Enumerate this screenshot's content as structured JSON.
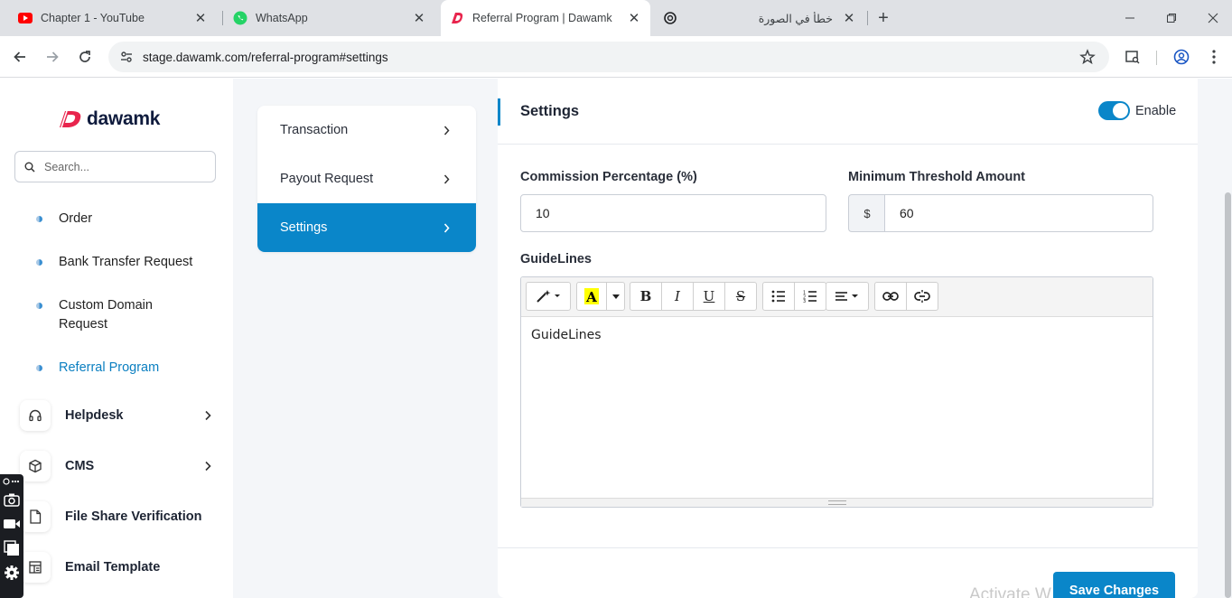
{
  "browser": {
    "tabs": [
      {
        "title": "Chapter 1 - YouTube",
        "favicon": "youtube-icon"
      },
      {
        "title": "WhatsApp",
        "favicon": "whatsapp-icon"
      },
      {
        "title": "Referral Program | Dawamk",
        "favicon": "dawamk-icon",
        "active": true
      },
      {
        "title": "خطأ في الصورة",
        "favicon": "chatgpt-icon"
      }
    ],
    "url": "stage.dawamk.com/referral-program#settings"
  },
  "sidebar": {
    "brand": "dawamk",
    "search_placeholder": "Search...",
    "sub_items": [
      {
        "label": "Order"
      },
      {
        "label": "Bank Transfer Request"
      },
      {
        "label": "Custom Domain Request"
      },
      {
        "label": "Referral Program",
        "active": true
      }
    ],
    "menu_items": [
      {
        "label": "Helpdesk",
        "icon": "headset-icon"
      },
      {
        "label": "CMS",
        "icon": "cube-icon"
      },
      {
        "label": "File Share Verification",
        "icon": "file-icon"
      },
      {
        "label": "Email Template",
        "icon": "template-icon"
      }
    ]
  },
  "subnav": {
    "items": [
      {
        "label": "Transaction"
      },
      {
        "label": "Payout Request"
      },
      {
        "label": "Settings",
        "active": true
      }
    ]
  },
  "settings": {
    "title": "Settings",
    "enable_label": "Enable",
    "enabled": true,
    "commission_label": "Commission Percentage (%)",
    "commission_value": "10",
    "threshold_label": "Minimum Threshold Amount",
    "currency_symbol": "$",
    "threshold_value": "60",
    "guidelines_label": "GuideLines",
    "guidelines_content": "GuideLines",
    "save_label": "Save Changes"
  },
  "watermark": "Activate Windows",
  "colors": {
    "primary": "#0a86c9",
    "sidebar_bg": "#ffffff",
    "page_bg": "#f4f6f9"
  }
}
